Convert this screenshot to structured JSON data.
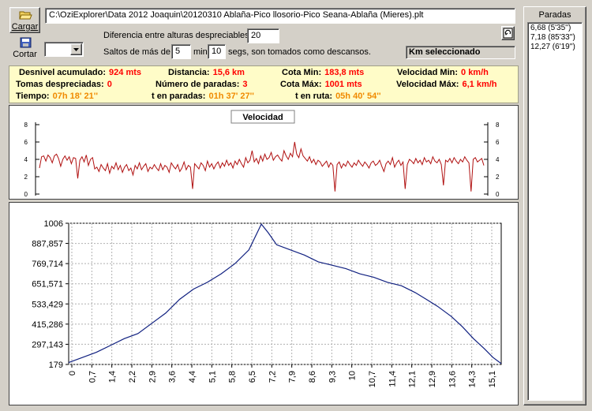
{
  "toolbar": {
    "load_label": "Cargar",
    "cut_label": "Cortar",
    "file_path": "C:\\OziExplorer\\Data 2012 Joaquin\\20120310 Ablaña-Pico llosorio-Pico Seana-Ablaña (Mieres).plt"
  },
  "settings": {
    "altitude_diff_label": "Diferencia entre alturas despreciables:",
    "altitude_diff_value": "20",
    "jumps_label": "Saltos de más de",
    "jumps_min_value": "5",
    "min_label": "min",
    "jumps_sec_value": "10",
    "sec_label": "segs, son tomados como descansos.",
    "km_selected_label": "Km seleccionado"
  },
  "stats": {
    "desnivel_label": "Desnivel acumulado:",
    "desnivel_value": "924 mts",
    "distancia_label": "Distancia:",
    "distancia_value": "15,6 km",
    "cota_min_label": "Cota Min:",
    "cota_min_value": "183,8 mts",
    "vel_min_label": "Velocidad Min:",
    "vel_min_value": "0 km/h",
    "tomas_label": "Tomas despreciadas:",
    "tomas_value": "0",
    "paradas_label": "Número de paradas:",
    "paradas_value": "3",
    "cota_max_label": "Cota Máx:",
    "cota_max_value": "1001 mts",
    "vel_max_label": "Velocidad Máx:",
    "vel_max_value": "6,1 km/h",
    "tiempo_label": "Tiempo:",
    "tiempo_value": "07h 18' 21''",
    "t_paradas_label": "t en paradas:",
    "t_paradas_value": "01h 37' 27''",
    "t_ruta_label": "t en ruta:",
    "t_ruta_value": "05h 40' 54''"
  },
  "sidebar": {
    "title": "Paradas",
    "items": [
      "6,68 (5'35'')",
      "7,18 (85'33'')",
      "12,27 (6'19'')"
    ]
  },
  "chart_data": [
    {
      "type": "line",
      "title": "Velocidad",
      "ylim": [
        0,
        8
      ],
      "yticks": [
        "0",
        "2",
        "4",
        "6",
        "8"
      ],
      "y_samples": [
        3.0,
        4.3,
        4.4,
        3.8,
        4.5,
        4.2,
        3.6,
        4.4,
        4.6,
        4.1,
        3.2,
        4.0,
        4.4,
        3.9,
        4.3,
        3.5,
        4.2,
        4.1,
        1.8,
        3.9,
        4.3,
        3.7,
        4.5,
        3.3,
        4.0,
        4.2,
        2.9,
        3.1,
        2.6,
        3.4,
        3.0,
        2.7,
        3.5,
        2.4,
        3.2,
        2.9,
        3.6,
        2.8,
        3.3,
        2.5,
        3.1,
        3.4,
        2.7,
        3.0,
        2.2,
        3.3,
        2.9,
        3.6,
        2.8,
        3.2,
        3.5,
        2.6,
        3.1,
        2.9,
        3.4,
        3.0,
        2.7,
        3.5,
        2.8,
        3.3,
        3.1,
        2.5,
        3.6,
        3.2,
        2.9,
        3.4,
        2.6,
        3.0,
        3.7,
        2.8,
        3.3,
        3.1,
        0.6,
        3.5,
        3.2,
        2.9,
        3.6,
        3.3,
        2.7,
        3.8,
        3.1,
        3.5,
        2.9,
        3.4,
        3.7,
        3.0,
        3.6,
        3.2,
        3.9,
        3.3,
        3.6,
        3.0,
        3.8,
        3.4,
        4.0,
        3.5,
        3.1,
        4.2,
        3.6,
        3.9,
        5.0,
        3.7,
        4.1,
        3.5,
        4.4,
        3.8,
        4.6,
        4.0,
        4.2,
        4.8,
        3.9,
        4.3,
        4.5,
        4.1,
        3.8,
        5.0,
        4.4,
        4.0,
        4.7,
        4.3,
        6.0,
        4.6,
        4.2,
        5.2,
        4.4,
        4.1,
        3.8,
        4.3,
        3.6,
        4.0,
        3.4,
        3.9,
        3.7,
        3.2,
        3.5,
        3.8,
        3.1,
        3.6,
        3.3,
        0.3,
        3.4,
        3.7,
        3.0,
        3.5,
        3.2,
        3.8,
        3.4,
        3.1,
        3.6,
        3.3,
        3.9,
        3.5,
        3.2,
        3.7,
        3.4,
        3.0,
        3.6,
        3.8,
        3.3,
        3.5,
        3.9,
        3.2,
        2.6,
        3.5,
        3.8,
        3.4,
        4.2,
        3.1,
        3.6,
        3.9,
        3.3,
        3.7,
        0.6,
        3.4,
        4.0,
        3.8,
        3.5,
        4.1,
        3.6,
        3.9,
        3.4,
        4.2,
        3.7,
        3.9,
        3.5,
        4.3,
        3.8,
        3.6,
        4.0,
        3.4,
        1.0,
        3.9,
        3.7,
        4.1,
        3.6,
        4.2,
        3.8,
        3.5,
        4.0,
        3.7,
        4.3,
        3.9,
        3.6,
        0.3,
        4.0,
        4.2,
        3.7,
        3.9,
        4.1,
        3.3
      ]
    },
    {
      "type": "line",
      "ylim": [
        179,
        1006
      ],
      "yticks": [
        "179",
        "297,143",
        "415,286",
        "533,429",
        "651,571",
        "769,714",
        "887,857",
        "1006"
      ],
      "xticks": [
        "0",
        "0,7",
        "1,4",
        "2,2",
        "2,9",
        "3,6",
        "4,4",
        "5,1",
        "5,8",
        "6,5",
        "7,2",
        "7,9",
        "8,6",
        "9,3",
        "10",
        "10,7",
        "11,4",
        "12,1",
        "12,9",
        "13,6",
        "14,3",
        "15,1"
      ],
      "xlim": [
        0,
        15.6
      ],
      "x": [
        0,
        0.5,
        1.0,
        1.5,
        2.0,
        2.5,
        3.0,
        3.5,
        4.0,
        4.5,
        5.0,
        5.5,
        6.0,
        6.5,
        6.95,
        7.2,
        7.5,
        8.0,
        8.5,
        9.0,
        9.5,
        10.0,
        10.5,
        11.0,
        11.5,
        12.0,
        12.5,
        12.9,
        13.3,
        13.8,
        14.2,
        14.6,
        15.0,
        15.3,
        15.6
      ],
      "y": [
        190,
        220,
        250,
        290,
        330,
        360,
        420,
        480,
        560,
        620,
        660,
        710,
        770,
        850,
        1001,
        950,
        880,
        850,
        820,
        780,
        760,
        740,
        710,
        690,
        660,
        640,
        600,
        560,
        520,
        460,
        400,
        330,
        270,
        220,
        184
      ]
    }
  ]
}
